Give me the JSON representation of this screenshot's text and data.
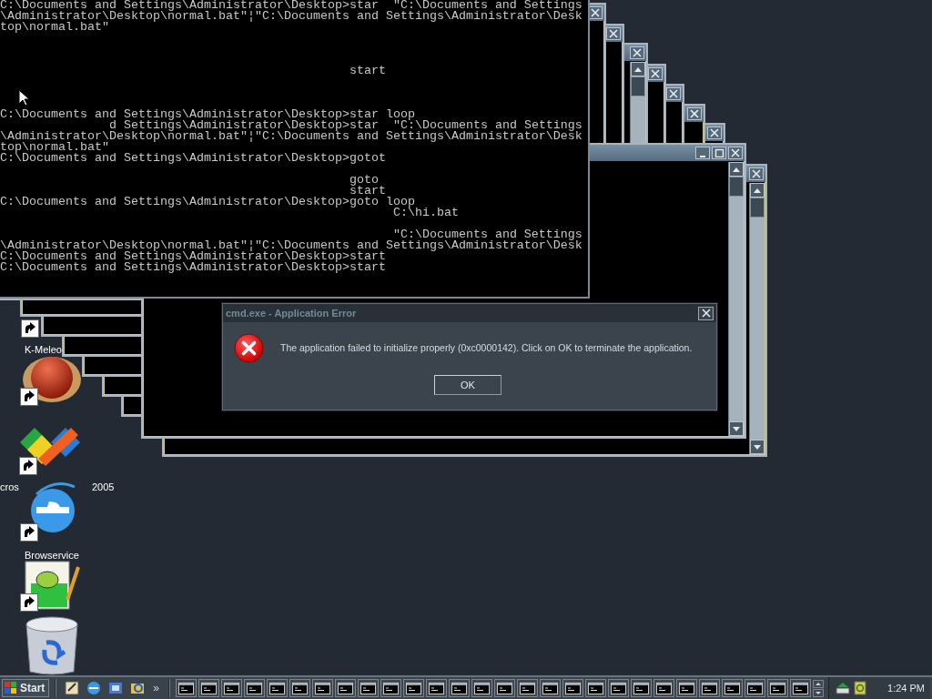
{
  "console": {
    "lines": [
      {
        "kind": "text",
        "text": "C:\\Documents and Settings\\Administrator\\Desktop>star  \"C:\\Documents and Settings"
      },
      {
        "kind": "text",
        "text": "\\Administrator\\Desktop\\normal.bat\"¦\"C:\\Documents and Settings\\Administrator\\Desk"
      },
      {
        "kind": "text",
        "text": "top\\normal.bat\""
      },
      {
        "kind": "blank"
      },
      {
        "kind": "blank"
      },
      {
        "kind": "blank"
      },
      {
        "kind": "text",
        "text": "                                                start"
      },
      {
        "kind": "blank"
      },
      {
        "kind": "blank"
      },
      {
        "kind": "blank"
      },
      {
        "kind": "text",
        "text": "C:\\Documents and Settings\\Administrator\\Desktop>star loop"
      },
      {
        "kind": "text",
        "text": "               d Settings\\Administrator\\Desktop>star  \"C:\\Documents and Settings"
      },
      {
        "kind": "text",
        "text": "\\Administrator\\Desktop\\normal.bat\"¦\"C:\\Documents and Settings\\Administrator\\Desk"
      },
      {
        "kind": "text",
        "text": "top\\normal.bat\""
      },
      {
        "kind": "text",
        "text": "C:\\Documents and Settings\\Administrator\\Desktop>gotot"
      },
      {
        "kind": "blank"
      },
      {
        "kind": "text",
        "text": "                                                goto"
      },
      {
        "kind": "text",
        "text": "                                                start"
      },
      {
        "kind": "text",
        "text": "C:\\Documents and Settings\\Administrator\\Desktop>goto loop"
      },
      {
        "kind": "text",
        "text": "                                                      C:\\hi.bat"
      },
      {
        "kind": "blank"
      },
      {
        "kind": "text",
        "text": "                                                      \"C:\\Documents and Settings"
      },
      {
        "kind": "text",
        "text": "\\Administrator\\Desktop\\normal.bat\"¦\"C:\\Documents and Settings\\Administrator\\Desk"
      },
      {
        "kind": "text",
        "text": "C:\\Documents and Settings\\Administrator\\Desktop>start"
      },
      {
        "kind": "text",
        "text": "C:\\Documents and Settings\\Administrator\\Desktop>start"
      }
    ]
  },
  "desktop_icons": [
    {
      "kind": "shortcut",
      "label": "K-Meleo"
    },
    {
      "kind": "ball"
    },
    {
      "kind": "ribbon",
      "label_parts": [
        "cros",
        "2005"
      ]
    },
    {
      "kind": "browser",
      "label": "Browservice"
    },
    {
      "kind": "notepad"
    },
    {
      "kind": "bin"
    }
  ],
  "error_dialog": {
    "title": "cmd.exe - Application Error",
    "message": "The application failed to initialize properly (0xc0000142). Click on OK to terminate the application.",
    "button": "OK"
  },
  "taskbar": {
    "start": "Start",
    "overflow": "»",
    "clock": "1:24 PM"
  }
}
